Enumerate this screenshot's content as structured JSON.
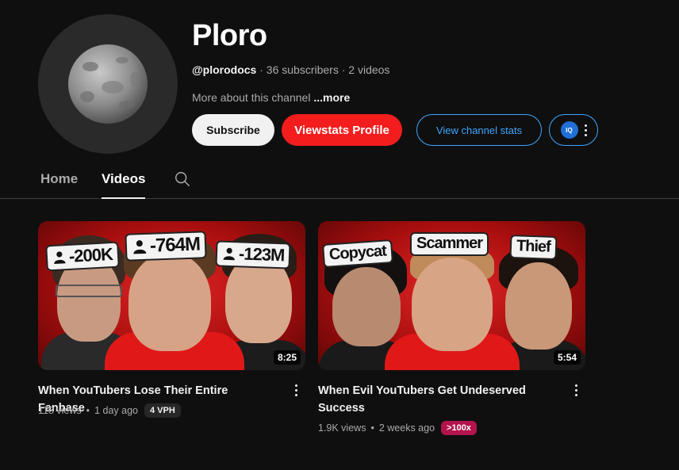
{
  "channel": {
    "name": "Ploro",
    "handle": "@plorodocs",
    "subscribers": "36 subscribers",
    "videos_count": "2 videos",
    "separator": "·",
    "about": "More about this channel",
    "about_more": "...more"
  },
  "buttons": {
    "subscribe": "Subscribe",
    "viewstats_profile": "Viewstats Profile",
    "view_channel_stats": "View channel stats",
    "extension_badge": "IQ"
  },
  "tabs": [
    {
      "label": "Home",
      "active": false
    },
    {
      "label": "Videos",
      "active": true
    }
  ],
  "videos": [
    {
      "title": "When YouTubers Lose Their Entire Fanbase",
      "views": "118 views",
      "age": "1 day ago",
      "badge": "4 VPH",
      "duration": "8:25",
      "thumb_tags": [
        "-200K",
        "-764M",
        "-123M"
      ]
    },
    {
      "title": "When Evil YouTubers Get Undeserved Success",
      "views": "1.9K views",
      "age": "2 weeks ago",
      "badge": ">100x",
      "duration": "5:54",
      "thumb_tags": [
        "Copycat",
        "Scammer",
        "Thief"
      ]
    }
  ],
  "colors": {
    "background": "#0f0f0f",
    "viewstats_red": "#f41d1d",
    "link_blue": "#3ea6ff",
    "outlier_badge": "#b3134c"
  },
  "icons": [
    "avatar-planet",
    "search-icon",
    "person-icon",
    "kebab-icon",
    "more-vert-icon"
  ]
}
